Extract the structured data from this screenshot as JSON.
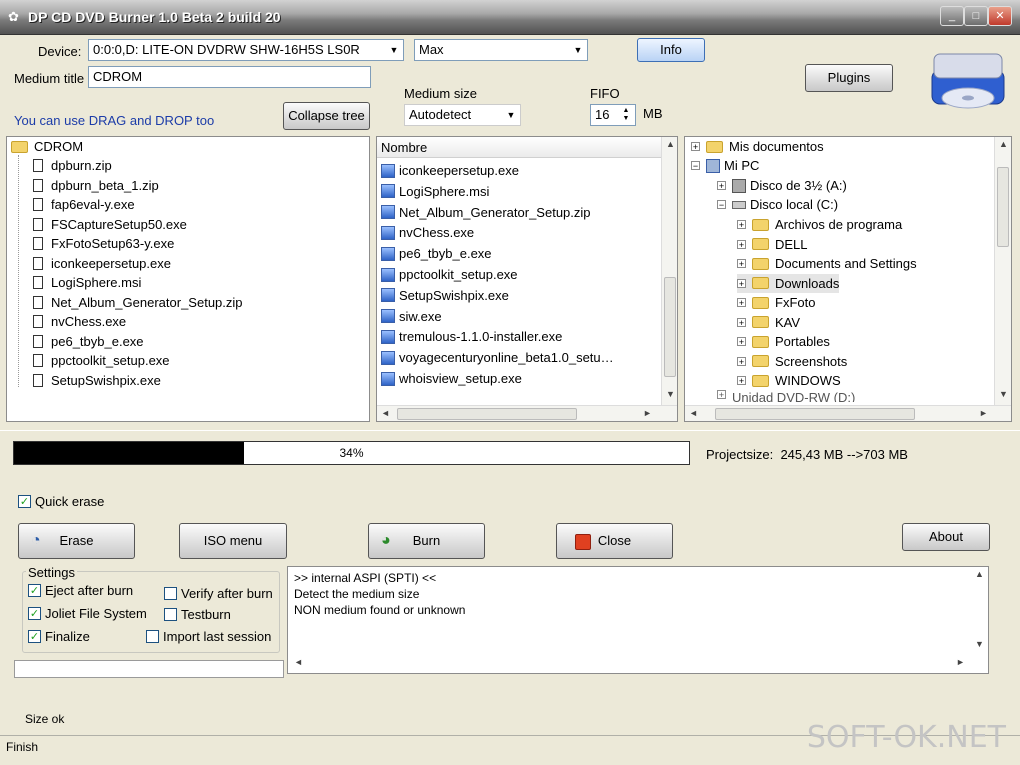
{
  "window": {
    "title": "DP CD DVD Burner 1.0  Beta 2 build 20"
  },
  "device": {
    "label": "Device:",
    "value": "0:0:0,D: LITE-ON DVDRW SHW-16H5S LS0R",
    "speed": "Max"
  },
  "info_label": "Info",
  "plugins_label": "Plugins",
  "medium_title": {
    "label": "Medium title",
    "value": "CDROM"
  },
  "medium_size": {
    "label": "Medium size",
    "value": "Autodetect"
  },
  "fifo": {
    "label": "FIFO",
    "value": "16",
    "unit": "MB"
  },
  "dragdrop_hint": "You can use DRAG and DROP too",
  "collapse_label": "Collapse tree",
  "project_tree": {
    "root": "CDROM",
    "items": [
      "dpburn.zip",
      "dpburn_beta_1.zip",
      "fap6eval-y.exe",
      "FSCaptureSetup50.exe",
      "FxFotoSetup63-y.exe",
      "iconkeepersetup.exe",
      "LogiSphere.msi",
      "Net_Album_Generator_Setup.zip",
      "nvChess.exe",
      "pe6_tbyb_e.exe",
      "ppctoolkit_setup.exe",
      "SetupSwishpix.exe"
    ]
  },
  "file_list": {
    "header": "Nombre",
    "items": [
      "iconkeepersetup.exe",
      "LogiSphere.msi",
      "Net_Album_Generator_Setup.zip",
      "nvChess.exe",
      "pe6_tbyb_e.exe",
      "ppctoolkit_setup.exe",
      "SetupSwishpix.exe",
      "siw.exe",
      "tremulous-1.1.0-installer.exe",
      "voyagecenturyonline_beta1.0_setu…",
      "whoisview_setup.exe"
    ]
  },
  "explorer": {
    "my_docs": "Mis documentos",
    "my_pc": "Mi PC",
    "floppy": "Disco de 3½ (A:)",
    "local": "Disco local (C:)",
    "folders": [
      "Archivos de programa",
      "DELL",
      "Documents and Settings",
      "Downloads",
      "FxFoto",
      "KAV",
      "Portables",
      "Screenshots",
      "WINDOWS"
    ],
    "dvd": "Unidad DVD-RW (D:)"
  },
  "progress": {
    "percent": 34,
    "label": "34%"
  },
  "projectsize": {
    "label": "Projectsize:",
    "value": "245,43 MB -->703 MB"
  },
  "quick_erase": "Quick erase",
  "buttons": {
    "erase": "Erase",
    "iso": "ISO menu",
    "burn": "Burn",
    "close": "Close",
    "about": "About"
  },
  "settings": {
    "title": "Settings",
    "eject": "Eject after burn",
    "verify": "Verify after burn",
    "joliet": "Joliet File System",
    "testburn": "Testburn",
    "finalize": "Finalize",
    "import": "Import last session"
  },
  "log": [
    ">> internal ASPI (SPTI) <<",
    "Detect the medium size",
    "NON medium found or unknown"
  ],
  "size_ok": "Size ok",
  "status": "Finish",
  "watermark": "SOFT-OK.NET",
  "colors": {
    "progress_fill": "#000000",
    "folder": "#f3d36b",
    "check": "#21a121"
  }
}
